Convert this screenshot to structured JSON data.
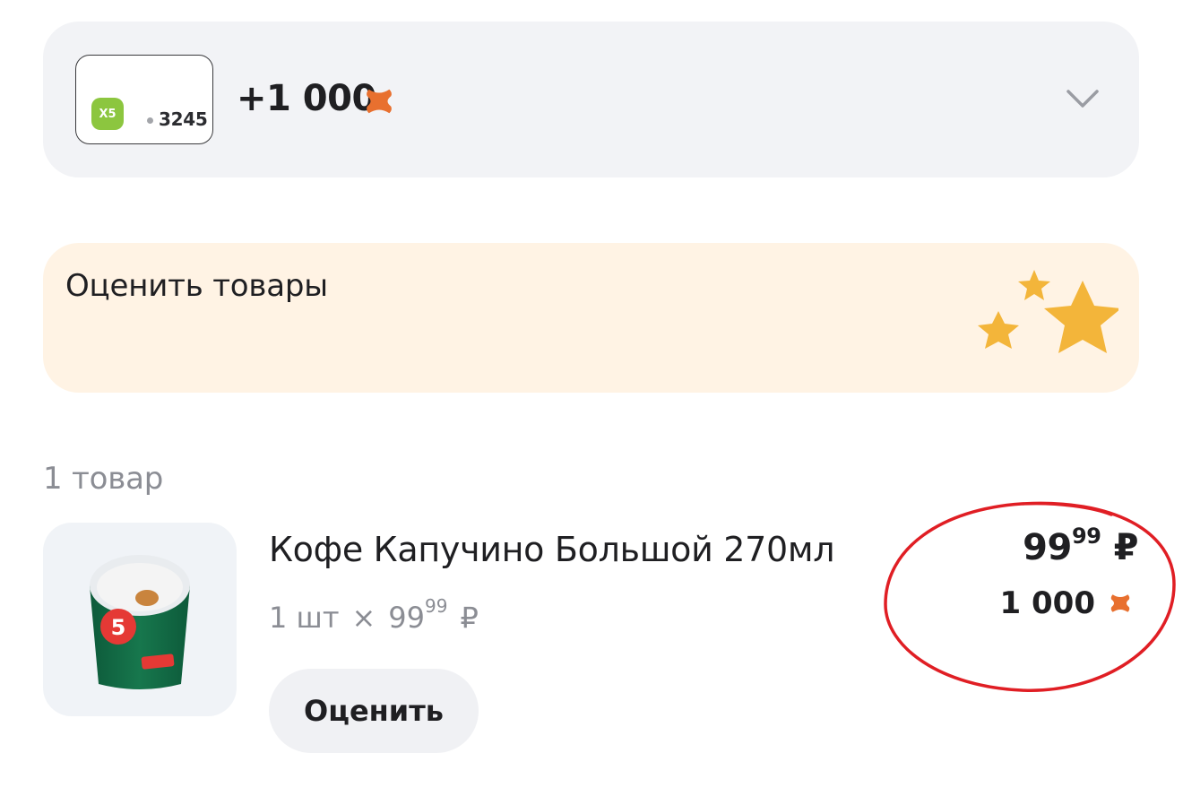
{
  "loyalty": {
    "card_brand": "X5",
    "card_number": "3245",
    "bonus_total": "+1 000",
    "bonus_icon": "x5-points-icon",
    "expand_icon": "chevron-down-icon"
  },
  "rate_banner": {
    "title": "Оценить товары",
    "decoration": "stars-icon"
  },
  "order": {
    "items_count": "1 товар",
    "items": [
      {
        "title": "Кофе Капучино Большой 270мл",
        "quantity": "1 шт",
        "times": "×",
        "unit_price_main": "99",
        "unit_price_cents": "99",
        "currency": "₽",
        "total_main": "99",
        "total_cents": "99",
        "points": "1 000",
        "rate_button": "Оценить",
        "image_icon": "coffee-cup-image"
      }
    ]
  },
  "colors": {
    "accent_orange": "#e8702f",
    "star_yellow": "#f3b53a",
    "x5_green": "#8cc63f",
    "highlight_red": "#e01e24",
    "banner_bg": "#fff3e4",
    "card_bg": "#f2f3f6"
  }
}
